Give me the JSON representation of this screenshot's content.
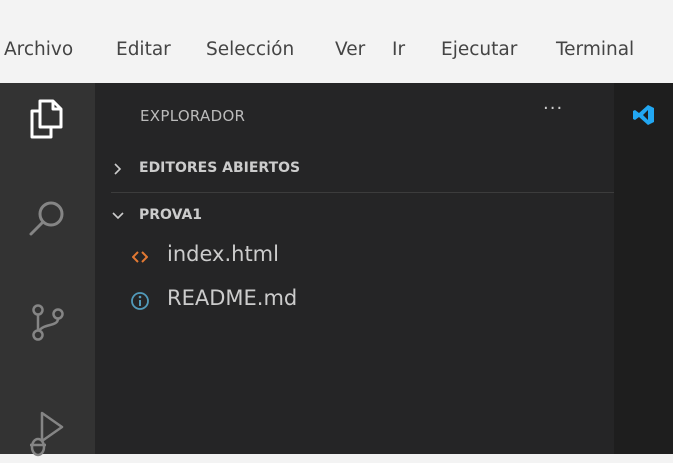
{
  "menu": [
    "Archivo",
    "Editar",
    "Selección",
    "Ver",
    "Ir",
    "Ejecutar",
    "Terminal"
  ],
  "activity_bar": {
    "icons": [
      "files-icon",
      "search-icon",
      "source-control-icon",
      "run-debug-icon"
    ]
  },
  "explorer": {
    "title": "EXPLORADOR",
    "more_actions": "···",
    "open_editors_label": "EDITORES ABIERTOS",
    "folder_label": "PROVA1",
    "files": [
      {
        "name": "index.html",
        "icon": "html-file-icon"
      },
      {
        "name": "README.md",
        "icon": "info-file-icon"
      }
    ]
  },
  "colors": {
    "menubar_bg": "#f3f3f3",
    "activitybar_bg": "#333333",
    "sidebar_bg": "#252526",
    "editor_bg": "#1e1e1e",
    "html_icon": "#e37933",
    "info_icon": "#519aba",
    "vscode_logo": "#22a7f2"
  }
}
